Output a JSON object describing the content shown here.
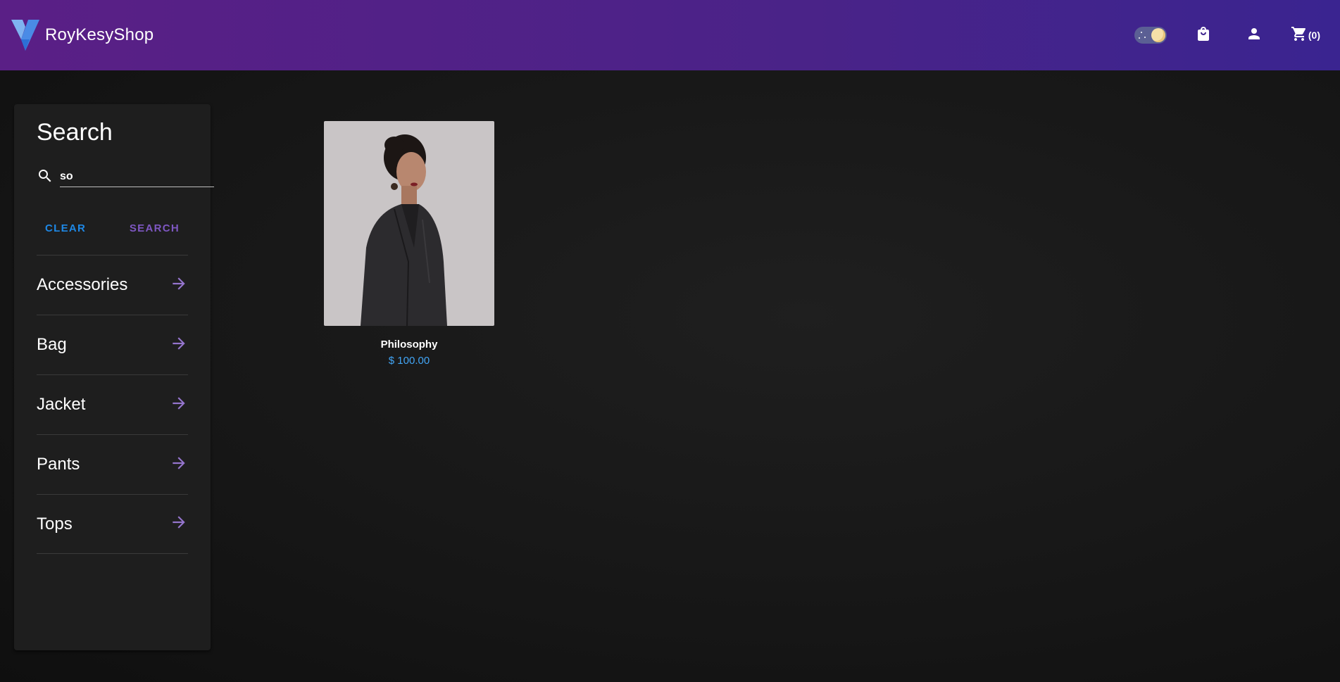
{
  "app": {
    "brand_name": "RoyKesyShop",
    "logo_icon": "vuetify-v-logo"
  },
  "header": {
    "theme_toggle": {
      "icon": "moon-toggle-icon",
      "state": "dark"
    },
    "shop_icon": "shopping-bag-icon",
    "account_icon": "account-icon",
    "cart_icon": "cart-icon",
    "cart_count": "(0)"
  },
  "search_panel": {
    "title": "Search",
    "search_value": "so",
    "clear_label": "CLEAR",
    "search_label": "SEARCH",
    "categories": [
      {
        "label": "Accessories"
      },
      {
        "label": "Bag"
      },
      {
        "label": "Jacket"
      },
      {
        "label": "Pants"
      },
      {
        "label": "Tops"
      }
    ]
  },
  "results": [
    {
      "name": "Philosophy",
      "price": "$ 100.00"
    }
  ],
  "colors": {
    "header_gradient_start": "#5a1f86",
    "header_gradient_end": "#3a2490",
    "clear_button": "#1e88e5",
    "search_button": "#7e57c2",
    "arrow": "#9575cd",
    "price": "#42a5f5"
  }
}
